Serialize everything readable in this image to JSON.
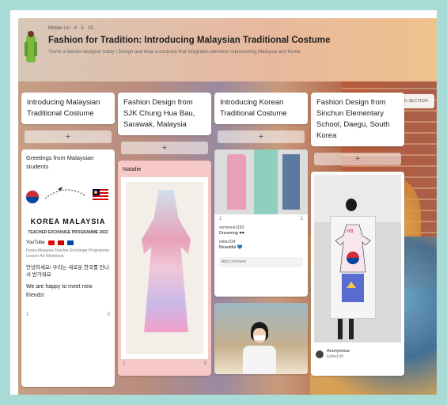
{
  "header": {
    "author": "Mobile Lin · 4 · 5 · 15",
    "title": "Fashion for Tradition: Introducing Malaysian Traditional Costume",
    "subtitle": "You're a fashion designer today | Design and draw a costume that integrates elements representing Malaysia and Korea"
  },
  "add_section_label": "ADD SECTION",
  "add_post_glyph": "+",
  "columns": [
    {
      "title": "Introducing Malaysian Traditional Costume"
    },
    {
      "title": "Fashion Design from SJK Chung Hua Bau, Sarawak, Malaysia"
    },
    {
      "title": "Introducing Korean Traditional Costume"
    },
    {
      "title": "Fashion Design from Sinchun Elementary School, Daegu, South Korea"
    }
  ],
  "col1_card": {
    "title": "Greetings from Malaysian students",
    "banner": "KOREA MALAYSIA",
    "banner_sub": "TEACHER EXCHANGE PROGRAMME 2022",
    "link_label": "YouTube",
    "link_desc": "Korea-Malaysia Teacher Exchange Programme Lesson Art Workbook",
    "korean_text": "안녕하세요! 우리는 새로운 한국를 만나서 반가워요",
    "english_text": "We are happy to meet new friends!",
    "likes": "1",
    "comments": "0"
  },
  "col2_card": {
    "author": "Natalie",
    "likes": "1",
    "comments": "0"
  },
  "col3_card": {
    "likes": "1",
    "comments": "2",
    "comment1_author": "someone1163",
    "comment1_text": "Dreaming ♥♥",
    "comment2_author": "writer234",
    "comment2_text": "Beautiful 💙",
    "add_comment": "Add comment"
  },
  "col4_card": {
    "author": "Anonymous",
    "author_sub": "Edited 6h"
  },
  "colors": {
    "frame": "#a9dcd6",
    "pink_card": "#f6c8c8",
    "korea_red": "#cd2e3a",
    "korea_blue": "#0047a0"
  }
}
